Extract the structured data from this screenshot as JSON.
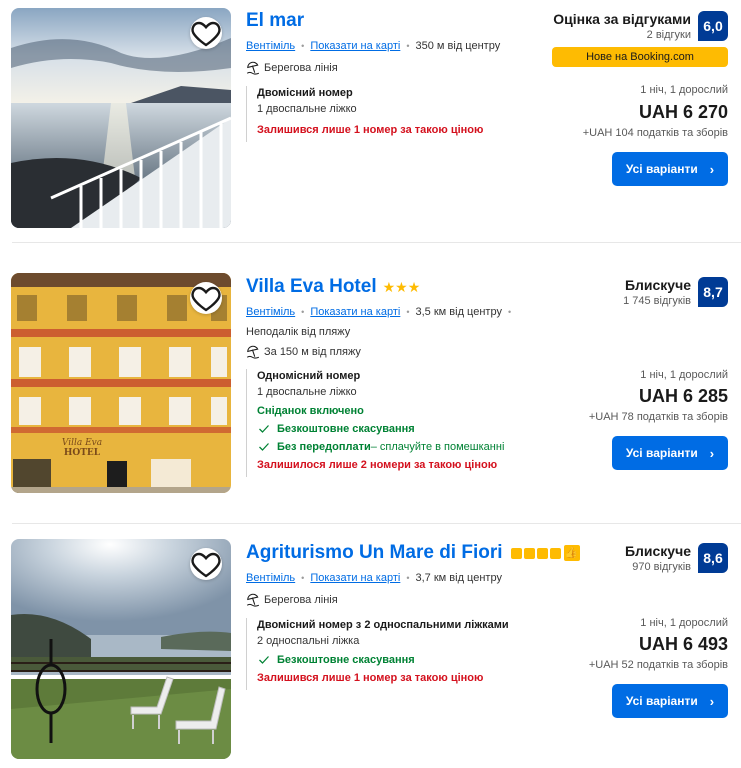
{
  "colors": {
    "link": "#006ce4",
    "score": "#003b95",
    "button": "#006ce4",
    "green": "#008234",
    "red": "#d4111e",
    "badge": "#febb02"
  },
  "icons": {
    "favorite": "heart-icon",
    "beach": "beach-umbrella-icon",
    "check": "checkmark-icon",
    "chevron": "chevron-right-icon",
    "thumb": "thumbs-up-icon"
  },
  "hotels": [
    {
      "name": "El mar",
      "city": "Вентіміль",
      "map_link": "Показати на карті",
      "distance": "350 м від центру",
      "feature": "Берегова лінія",
      "room_name": "Двомісний номер",
      "room_bed": "1 двоспальне ліжко",
      "scarcity": "Залишився лише 1 номер за такою ціною",
      "score_word": "Оцінка за відгуками",
      "score_count": "2 відгуки",
      "score": "6,0",
      "badge": "Нове на Booking.com",
      "nights": "1 ніч, 1 дорослий",
      "price": "UAH 6 270",
      "taxes": "+UAH 104 податків та зборів",
      "button": "Усі варіанти"
    },
    {
      "name": "Villa Eva Hotel",
      "stars": "★★★",
      "city": "Вентіміль",
      "map_link": "Показати на карті",
      "distance": "3,5 км від центру",
      "nearby": "Неподалік від пляжу",
      "feature": "За 150 м від пляжу",
      "room_name": "Одномісний номер",
      "room_bed": "1 двоспальне ліжко",
      "breakfast": "Сніданок включено",
      "free_cancel": "Безкоштовне скасування",
      "no_prepay": "Без передоплати",
      "no_prepay_rest": " – сплачуйте в помешканні",
      "scarcity": "Залишилося лише 2 номери за такою ціною",
      "score_word": "Блискуче",
      "score_count": "1 745 відгуків",
      "score": "8,7",
      "nights": "1 ніч, 1 дорослий",
      "price": "UAH 6 285",
      "taxes": "+UAH 78 податків та зборів",
      "button": "Усі варіанти",
      "sign_line1": "Villa Eva",
      "sign_line2": "HOTEL"
    },
    {
      "name": "Agriturismo Un Mare di Fiori",
      "city": "Вентіміль",
      "map_link": "Показати на карті",
      "distance": "3,7 км від центру",
      "feature": "Берегова лінія",
      "room_name": "Двомісний номер з 2 односпальними ліжками",
      "room_bed": "2 односпальні ліжка",
      "free_cancel": "Безкоштовне скасування",
      "scarcity": "Залишився лише 1 номер за такою ціною",
      "score_word": "Блискуче",
      "score_count": "970 відгуків",
      "score": "8,6",
      "nights": "1 ніч, 1 дорослий",
      "price": "UAH 6 493",
      "taxes": "+UAH 52 податків та зборів",
      "button": "Усі варіанти"
    }
  ]
}
